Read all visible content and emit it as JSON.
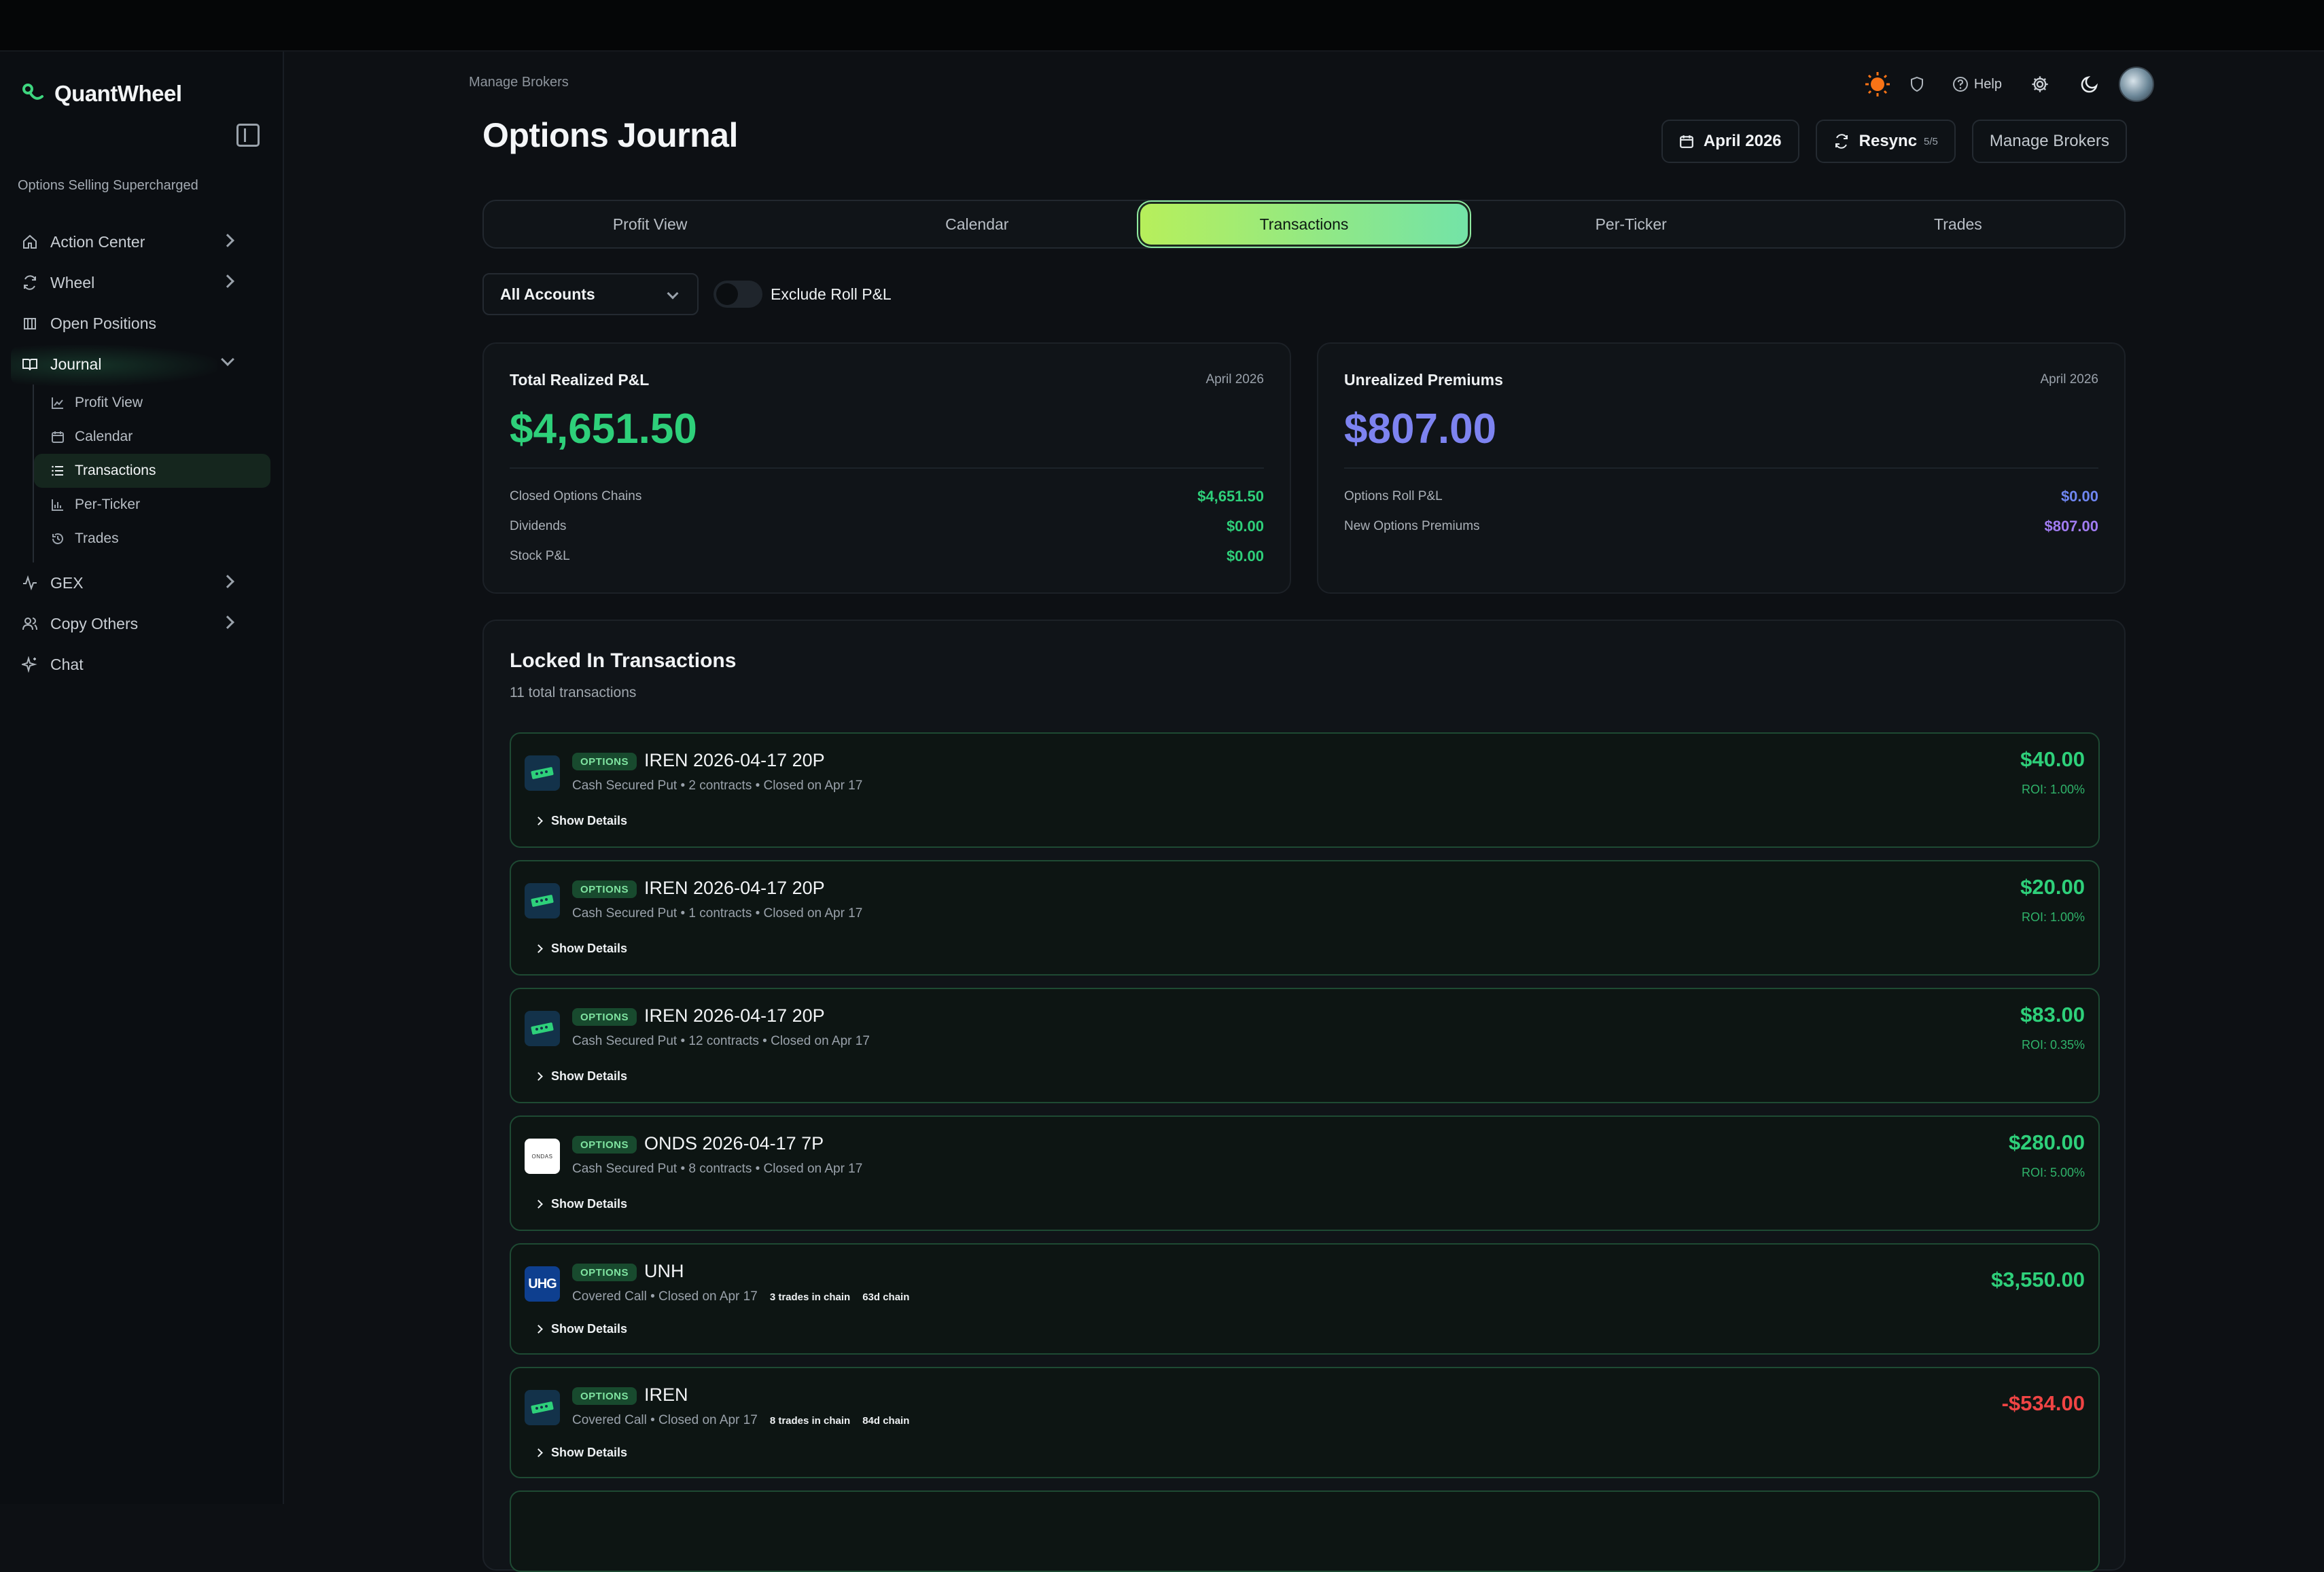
{
  "app": {
    "name": "QuantWheel",
    "tagline": "Options Selling Supercharged"
  },
  "sidebar": {
    "items": [
      {
        "label": "Action Center"
      },
      {
        "label": "Wheel"
      },
      {
        "label": "Open Positions"
      },
      {
        "label": "Journal"
      },
      {
        "label": "GEX"
      },
      {
        "label": "Copy Others"
      },
      {
        "label": "Chat"
      }
    ],
    "journal_sub": [
      {
        "label": "Profit View"
      },
      {
        "label": "Calendar"
      },
      {
        "label": "Transactions"
      },
      {
        "label": "Per-Ticker"
      },
      {
        "label": "Trades"
      }
    ]
  },
  "header": {
    "breadcrumb": "Manage Brokers",
    "title": "Options Journal",
    "help": "Help",
    "month_button": "April 2026",
    "resync_label": "Resync",
    "resync_count": "5/5",
    "manage_brokers": "Manage Brokers"
  },
  "tabs": [
    {
      "label": "Profit View"
    },
    {
      "label": "Calendar"
    },
    {
      "label": "Transactions"
    },
    {
      "label": "Per-Ticker"
    },
    {
      "label": "Trades"
    }
  ],
  "filters": {
    "account_select": "All Accounts",
    "exclude_roll_label": "Exclude Roll P&L"
  },
  "realized": {
    "title": "Total Realized P&L",
    "date": "April 2026",
    "total": "$4,651.50",
    "rows": [
      {
        "label": "Closed Options Chains",
        "value": "$4,651.50"
      },
      {
        "label": "Dividends",
        "value": "$0.00"
      },
      {
        "label": "Stock P&L",
        "value": "$0.00"
      }
    ]
  },
  "unrealized": {
    "title": "Unrealized Premiums",
    "date": "April 2026",
    "total": "$807.00",
    "rows": [
      {
        "label": "Options Roll P&L",
        "value": "$0.00"
      },
      {
        "label": "New Options Premiums",
        "value": "$807.00"
      }
    ]
  },
  "transactions": {
    "title": "Locked In Transactions",
    "subtitle": "11 total transactions",
    "badge": "OPTIONS",
    "show_details": "Show Details",
    "items": [
      {
        "name": "IREN 2026-04-17 20P",
        "meta": "Cash Secured Put • 2 contracts • Closed on Apr 17",
        "amount": "$40.00",
        "roi": "ROI: 1.00%",
        "logo": "iren"
      },
      {
        "name": "IREN 2026-04-17 20P",
        "meta": "Cash Secured Put • 1 contracts • Closed on Apr 17",
        "amount": "$20.00",
        "roi": "ROI: 1.00%",
        "logo": "iren"
      },
      {
        "name": "IREN 2026-04-17 20P",
        "meta": "Cash Secured Put • 12 contracts • Closed on Apr 17",
        "amount": "$83.00",
        "roi": "ROI: 0.35%",
        "logo": "iren"
      },
      {
        "name": "ONDS 2026-04-17 7P",
        "meta": "Cash Secured Put • 8 contracts • Closed on Apr 17",
        "amount": "$280.00",
        "roi": "ROI: 5.00%",
        "logo": "onds",
        "logo_text": "ONDAS"
      },
      {
        "name": "UNH",
        "meta": "Covered Call • Closed on Apr 17",
        "chip1": "3 trades in chain",
        "chip2": "63d chain",
        "amount": "$3,550.00",
        "logo": "uhg",
        "logo_text": "UHG"
      },
      {
        "name": "IREN",
        "meta": "Covered Call • Closed on Apr 17",
        "chip1": "8 trades in chain",
        "chip2": "84d chain",
        "amount": "-$534.00",
        "logo": "iren"
      }
    ]
  },
  "colors": {
    "accent_green": "#2ed07a",
    "accent_purple": "#7d83f0",
    "negative": "#ef4444"
  }
}
